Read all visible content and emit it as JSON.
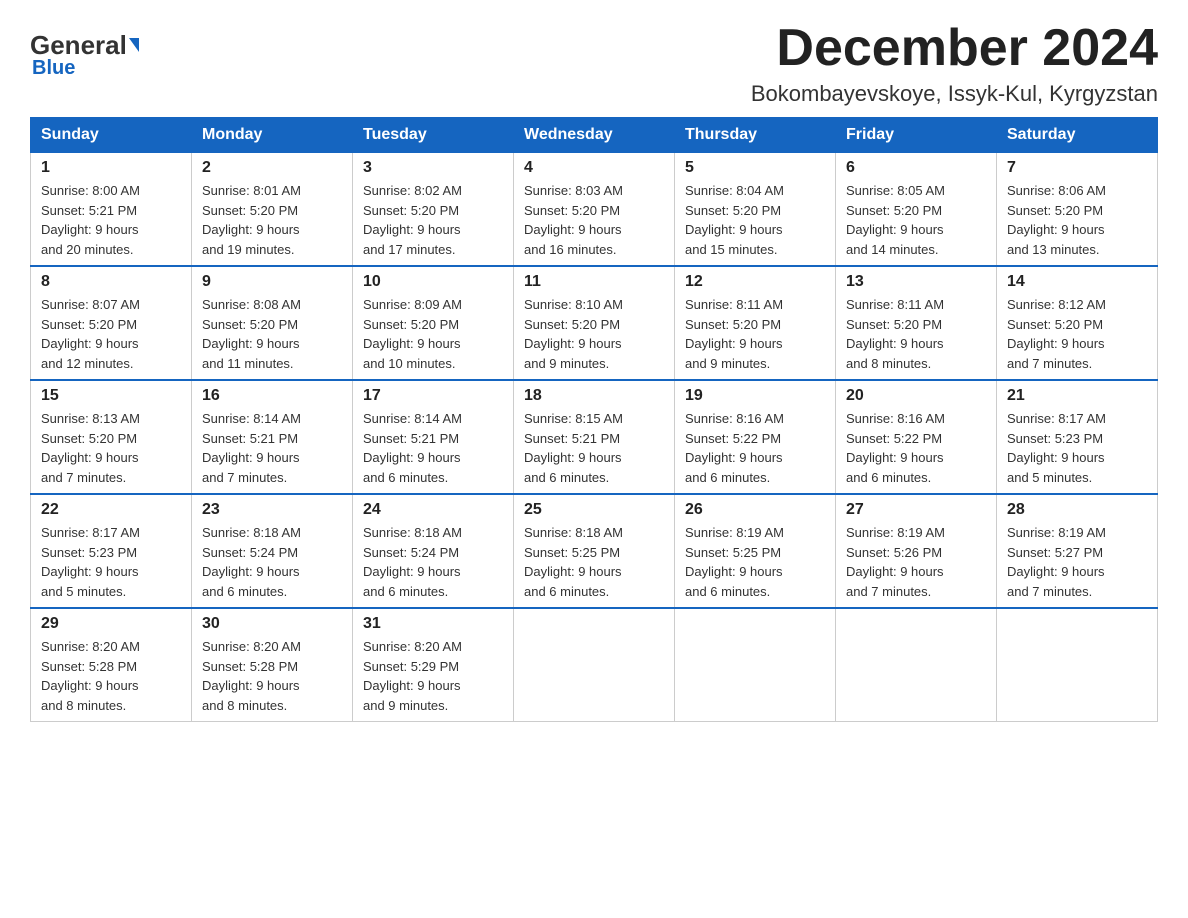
{
  "logo": {
    "general": "General",
    "blue": "Blue"
  },
  "header": {
    "month": "December 2024",
    "location": "Bokombayevskoye, Issyk-Kul, Kyrgyzstan"
  },
  "weekdays": [
    "Sunday",
    "Monday",
    "Tuesday",
    "Wednesday",
    "Thursday",
    "Friday",
    "Saturday"
  ],
  "weeks": [
    [
      {
        "day": "1",
        "sunrise": "8:00 AM",
        "sunset": "5:21 PM",
        "daylight": "9 hours and 20 minutes."
      },
      {
        "day": "2",
        "sunrise": "8:01 AM",
        "sunset": "5:20 PM",
        "daylight": "9 hours and 19 minutes."
      },
      {
        "day": "3",
        "sunrise": "8:02 AM",
        "sunset": "5:20 PM",
        "daylight": "9 hours and 17 minutes."
      },
      {
        "day": "4",
        "sunrise": "8:03 AM",
        "sunset": "5:20 PM",
        "daylight": "9 hours and 16 minutes."
      },
      {
        "day": "5",
        "sunrise": "8:04 AM",
        "sunset": "5:20 PM",
        "daylight": "9 hours and 15 minutes."
      },
      {
        "day": "6",
        "sunrise": "8:05 AM",
        "sunset": "5:20 PM",
        "daylight": "9 hours and 14 minutes."
      },
      {
        "day": "7",
        "sunrise": "8:06 AM",
        "sunset": "5:20 PM",
        "daylight": "9 hours and 13 minutes."
      }
    ],
    [
      {
        "day": "8",
        "sunrise": "8:07 AM",
        "sunset": "5:20 PM",
        "daylight": "9 hours and 12 minutes."
      },
      {
        "day": "9",
        "sunrise": "8:08 AM",
        "sunset": "5:20 PM",
        "daylight": "9 hours and 11 minutes."
      },
      {
        "day": "10",
        "sunrise": "8:09 AM",
        "sunset": "5:20 PM",
        "daylight": "9 hours and 10 minutes."
      },
      {
        "day": "11",
        "sunrise": "8:10 AM",
        "sunset": "5:20 PM",
        "daylight": "9 hours and 9 minutes."
      },
      {
        "day": "12",
        "sunrise": "8:11 AM",
        "sunset": "5:20 PM",
        "daylight": "9 hours and 9 minutes."
      },
      {
        "day": "13",
        "sunrise": "8:11 AM",
        "sunset": "5:20 PM",
        "daylight": "9 hours and 8 minutes."
      },
      {
        "day": "14",
        "sunrise": "8:12 AM",
        "sunset": "5:20 PM",
        "daylight": "9 hours and 7 minutes."
      }
    ],
    [
      {
        "day": "15",
        "sunrise": "8:13 AM",
        "sunset": "5:20 PM",
        "daylight": "9 hours and 7 minutes."
      },
      {
        "day": "16",
        "sunrise": "8:14 AM",
        "sunset": "5:21 PM",
        "daylight": "9 hours and 7 minutes."
      },
      {
        "day": "17",
        "sunrise": "8:14 AM",
        "sunset": "5:21 PM",
        "daylight": "9 hours and 6 minutes."
      },
      {
        "day": "18",
        "sunrise": "8:15 AM",
        "sunset": "5:21 PM",
        "daylight": "9 hours and 6 minutes."
      },
      {
        "day": "19",
        "sunrise": "8:16 AM",
        "sunset": "5:22 PM",
        "daylight": "9 hours and 6 minutes."
      },
      {
        "day": "20",
        "sunrise": "8:16 AM",
        "sunset": "5:22 PM",
        "daylight": "9 hours and 6 minutes."
      },
      {
        "day": "21",
        "sunrise": "8:17 AM",
        "sunset": "5:23 PM",
        "daylight": "9 hours and 5 minutes."
      }
    ],
    [
      {
        "day": "22",
        "sunrise": "8:17 AM",
        "sunset": "5:23 PM",
        "daylight": "9 hours and 5 minutes."
      },
      {
        "day": "23",
        "sunrise": "8:18 AM",
        "sunset": "5:24 PM",
        "daylight": "9 hours and 6 minutes."
      },
      {
        "day": "24",
        "sunrise": "8:18 AM",
        "sunset": "5:24 PM",
        "daylight": "9 hours and 6 minutes."
      },
      {
        "day": "25",
        "sunrise": "8:18 AM",
        "sunset": "5:25 PM",
        "daylight": "9 hours and 6 minutes."
      },
      {
        "day": "26",
        "sunrise": "8:19 AM",
        "sunset": "5:25 PM",
        "daylight": "9 hours and 6 minutes."
      },
      {
        "day": "27",
        "sunrise": "8:19 AM",
        "sunset": "5:26 PM",
        "daylight": "9 hours and 7 minutes."
      },
      {
        "day": "28",
        "sunrise": "8:19 AM",
        "sunset": "5:27 PM",
        "daylight": "9 hours and 7 minutes."
      }
    ],
    [
      {
        "day": "29",
        "sunrise": "8:20 AM",
        "sunset": "5:28 PM",
        "daylight": "9 hours and 8 minutes."
      },
      {
        "day": "30",
        "sunrise": "8:20 AM",
        "sunset": "5:28 PM",
        "daylight": "9 hours and 8 minutes."
      },
      {
        "day": "31",
        "sunrise": "8:20 AM",
        "sunset": "5:29 PM",
        "daylight": "9 hours and 9 minutes."
      },
      null,
      null,
      null,
      null
    ]
  ],
  "labels": {
    "sunrise": "Sunrise:",
    "sunset": "Sunset:",
    "daylight": "Daylight:"
  }
}
